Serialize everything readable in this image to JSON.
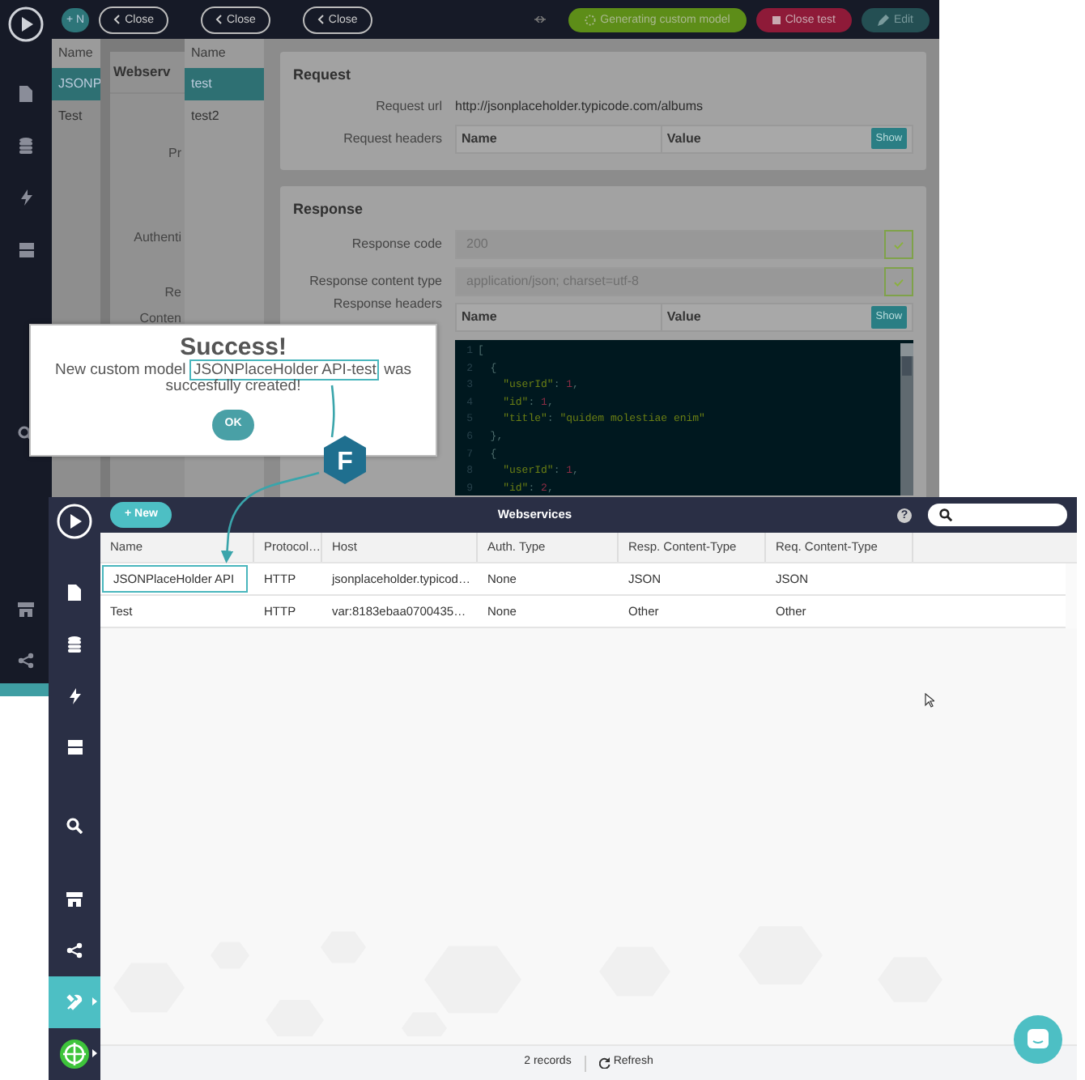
{
  "back_screen": {
    "toolbar": {
      "new_button": "+ N",
      "close_buttons": [
        "Close",
        "Close",
        "Close"
      ],
      "status_button": "Generating custom model",
      "close_test_button": "Close test",
      "edit_button": "Edit"
    },
    "webservice_list": {
      "header": "Name",
      "items": [
        {
          "label": "JSONP",
          "selected": true
        },
        {
          "label": "Test",
          "selected": false
        }
      ]
    },
    "detail_panel": {
      "title": "Webserv",
      "labels": [
        "Pr",
        "Authenti",
        "Re",
        "Conten"
      ]
    },
    "test_list": {
      "header": "Name",
      "items": [
        {
          "label": "test",
          "selected": true
        },
        {
          "label": "test2",
          "selected": false
        }
      ]
    },
    "request": {
      "title": "Request",
      "url_label": "Request url",
      "url": "http://jsonplaceholder.typicode.com/albums",
      "headers_label": "Request headers",
      "headers_columns": [
        "Name",
        "Value"
      ],
      "show_button": "Show"
    },
    "response": {
      "title": "Response",
      "fields": [
        {
          "label": "Response code",
          "value": "200",
          "valid": true
        },
        {
          "label": "Response content type",
          "value": "application/json; charset=utf-8",
          "valid": true
        }
      ],
      "headers_label": "Response headers",
      "headers_columns": [
        "Name",
        "Value"
      ],
      "show_button": "Show",
      "code_lines": [
        {
          "number": "1",
          "text": "["
        },
        {
          "number": "2",
          "text": "  {"
        },
        {
          "number": "3",
          "text": "    \"userId\": 1,"
        },
        {
          "number": "4",
          "text": "    \"id\": 1,"
        },
        {
          "number": "5",
          "text": "    \"title\": \"quidem molestiae enim\""
        },
        {
          "number": "6",
          "text": "  },"
        },
        {
          "number": "7",
          "text": "  {"
        },
        {
          "number": "8",
          "text": "    \"userId\": 1,"
        },
        {
          "number": "9",
          "text": "    \"id\": 2,"
        }
      ]
    }
  },
  "dialog": {
    "title": "Success!",
    "message_before": "New custom model",
    "model_name": "JSONPlaceHolder API-test",
    "message_after": "was succesfully created!",
    "ok_button": "OK"
  },
  "badge": "F",
  "front_screen": {
    "new_button": "+ New",
    "title": "Webservices",
    "help": "?",
    "table": {
      "columns": [
        "Name",
        "Protocol…",
        "Host",
        "Auth. Type",
        "Resp. Content-Type",
        "Req. Content-Type"
      ],
      "rows": [
        {
          "highlighted": true,
          "cells": [
            "JSONPlaceHolder API",
            "HTTP",
            "jsonplaceholder.typicod…",
            "None",
            "JSON",
            "JSON"
          ]
        },
        {
          "highlighted": false,
          "cells": [
            "Test",
            "HTTP",
            "var:8183ebaa0700435…",
            "None",
            "Other",
            "Other"
          ]
        }
      ]
    },
    "footer": {
      "records": "2 records",
      "refresh": "Refresh"
    }
  }
}
